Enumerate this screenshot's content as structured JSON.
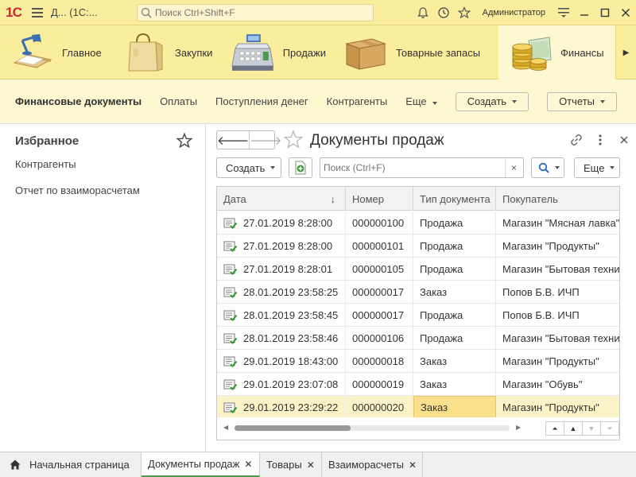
{
  "titlebar": {
    "logo": "1С",
    "title": "Д...  (1С:...",
    "search_placeholder": "Поиск Ctrl+Shift+F",
    "user": "Администратор"
  },
  "sections": [
    {
      "label": "Главное",
      "icon": "desk-lamp-icon"
    },
    {
      "label": "Закупки",
      "icon": "shopping-bag-icon"
    },
    {
      "label": "Продажи",
      "icon": "cash-register-icon"
    },
    {
      "label": "Товарные запасы",
      "icon": "box-icon"
    },
    {
      "label": "Финансы",
      "icon": "coins-icon"
    }
  ],
  "funcbar": {
    "title": "Финансовые документы",
    "items": [
      "Оплаты",
      "Поступления денег",
      "Контрагенты"
    ],
    "more": "Еще",
    "create_button": "Создать",
    "reports_button": "Отчеты"
  },
  "favorites": {
    "title": "Избранное",
    "items": [
      "Контрагенты",
      "Отчет по взаиморасчетам"
    ]
  },
  "form": {
    "title": "Документы продаж",
    "create_button": "Создать",
    "search_placeholder": "Поиск (Ctrl+F)",
    "more_button": "Еще"
  },
  "table": {
    "columns": [
      "Дата",
      "Номер",
      "Тип документа",
      "Покупатель"
    ],
    "rows": [
      {
        "date": "27.01.2019 8:28:00",
        "number": "000000100",
        "type": "Продажа",
        "customer": "Магазин \"Мясная лавка\""
      },
      {
        "date": "27.01.2019 8:28:00",
        "number": "000000101",
        "type": "Продажа",
        "customer": "Магазин \"Продукты\""
      },
      {
        "date": "27.01.2019 8:28:01",
        "number": "000000105",
        "type": "Продажа",
        "customer": "Магазин \"Бытовая техни"
      },
      {
        "date": "28.01.2019 23:58:25",
        "number": "000000017",
        "type": "Заказ",
        "customer": "Попов Б.В. ИЧП"
      },
      {
        "date": "28.01.2019 23:58:45",
        "number": "000000017",
        "type": "Продажа",
        "customer": "Попов Б.В. ИЧП"
      },
      {
        "date": "28.01.2019 23:58:46",
        "number": "000000106",
        "type": "Продажа",
        "customer": "Магазин \"Бытовая техни"
      },
      {
        "date": "29.01.2019 18:43:00",
        "number": "000000018",
        "type": "Заказ",
        "customer": "Магазин \"Продукты\""
      },
      {
        "date": "29.01.2019 23:07:08",
        "number": "000000019",
        "type": "Заказ",
        "customer": "Магазин \"Обувь\""
      },
      {
        "date": "29.01.2019 23:29:22",
        "number": "000000020",
        "type": "Заказ",
        "customer": "Магазин \"Продукты\""
      }
    ]
  },
  "tabs": [
    {
      "label": "Начальная страница",
      "icon": "home-icon"
    },
    {
      "label": "Документы продаж"
    },
    {
      "label": "Товары"
    },
    {
      "label": "Взаиморасчеты"
    }
  ],
  "colors": {
    "accent_yellow": "#fbed9e",
    "function_panel": "#fdf7d2",
    "selected_row": "#fbf3c8",
    "focused_cell": "#fbe08b",
    "logo_red": "#d0262a",
    "active_tab_underline": "#4a9a4a"
  }
}
